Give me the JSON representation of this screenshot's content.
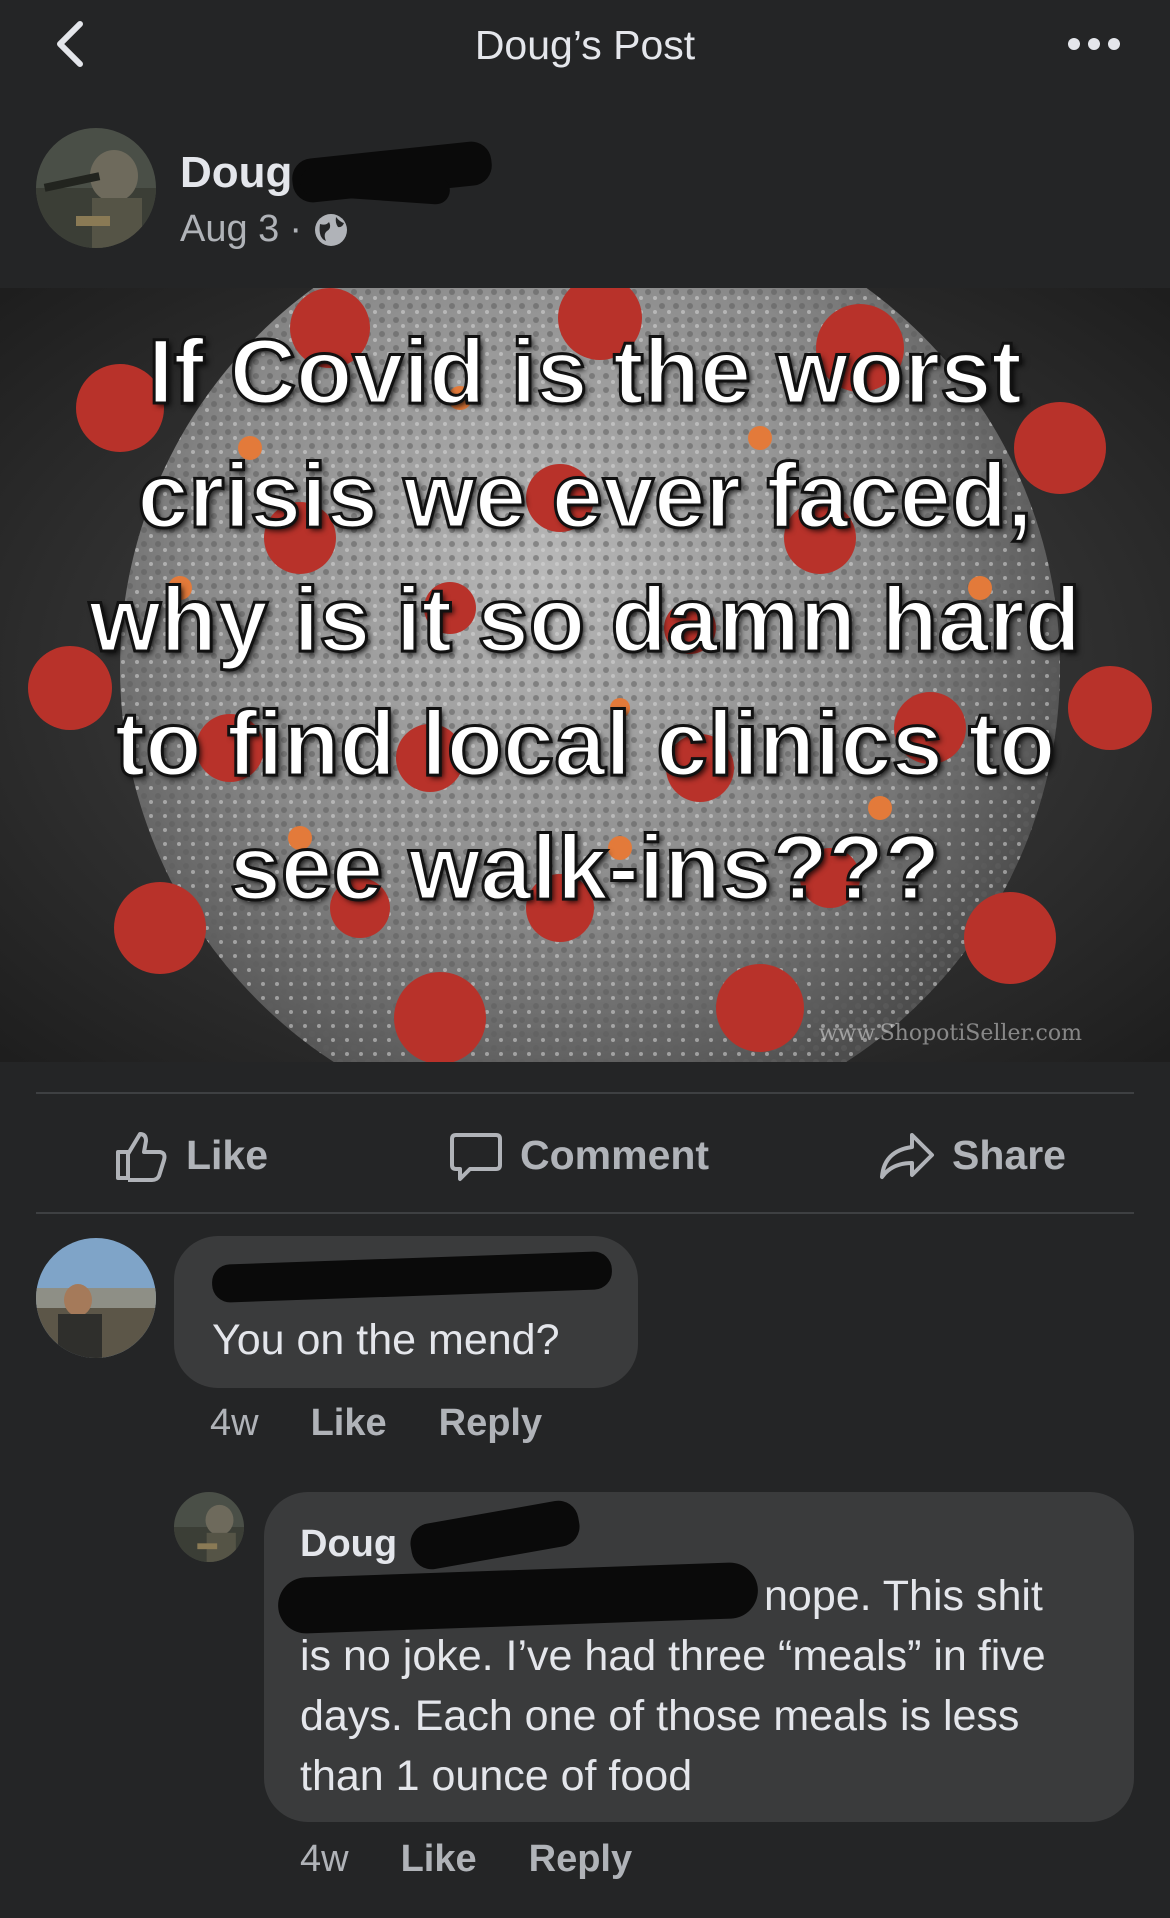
{
  "header": {
    "title": "Doug’s Post"
  },
  "post": {
    "author": "Doug",
    "date": "Aug 3",
    "separator": "·",
    "image_text": "If Covid is the worst crisis we ever faced, why is it so damn hard to find local clinics to see walk-ins???",
    "watermark": "www.ShopotiSeller.com"
  },
  "actions": {
    "like": "Like",
    "comment": "Comment",
    "share": "Share"
  },
  "comments": [
    {
      "text": "You on the mend?",
      "time": "4w",
      "like": "Like",
      "reply": "Reply"
    },
    {
      "author": "Doug",
      "text_line1": "nope. This shit",
      "text_rest": "is no joke. I’ve had three “meals” in five days. Each one of those meals is less than 1 ounce of food",
      "time": "4w",
      "like": "Like",
      "reply": "Reply"
    }
  ],
  "colors": {
    "background": "#242526",
    "bubble": "#3a3b3c",
    "text": "#e4e6eb",
    "muted": "#b0b3b8",
    "virus_red": "#b8322a"
  },
  "icons": [
    "chevron-left-icon",
    "more-horizontal-icon",
    "globe-icon",
    "thumbs-up-icon",
    "comment-icon",
    "share-arrow-icon"
  ]
}
